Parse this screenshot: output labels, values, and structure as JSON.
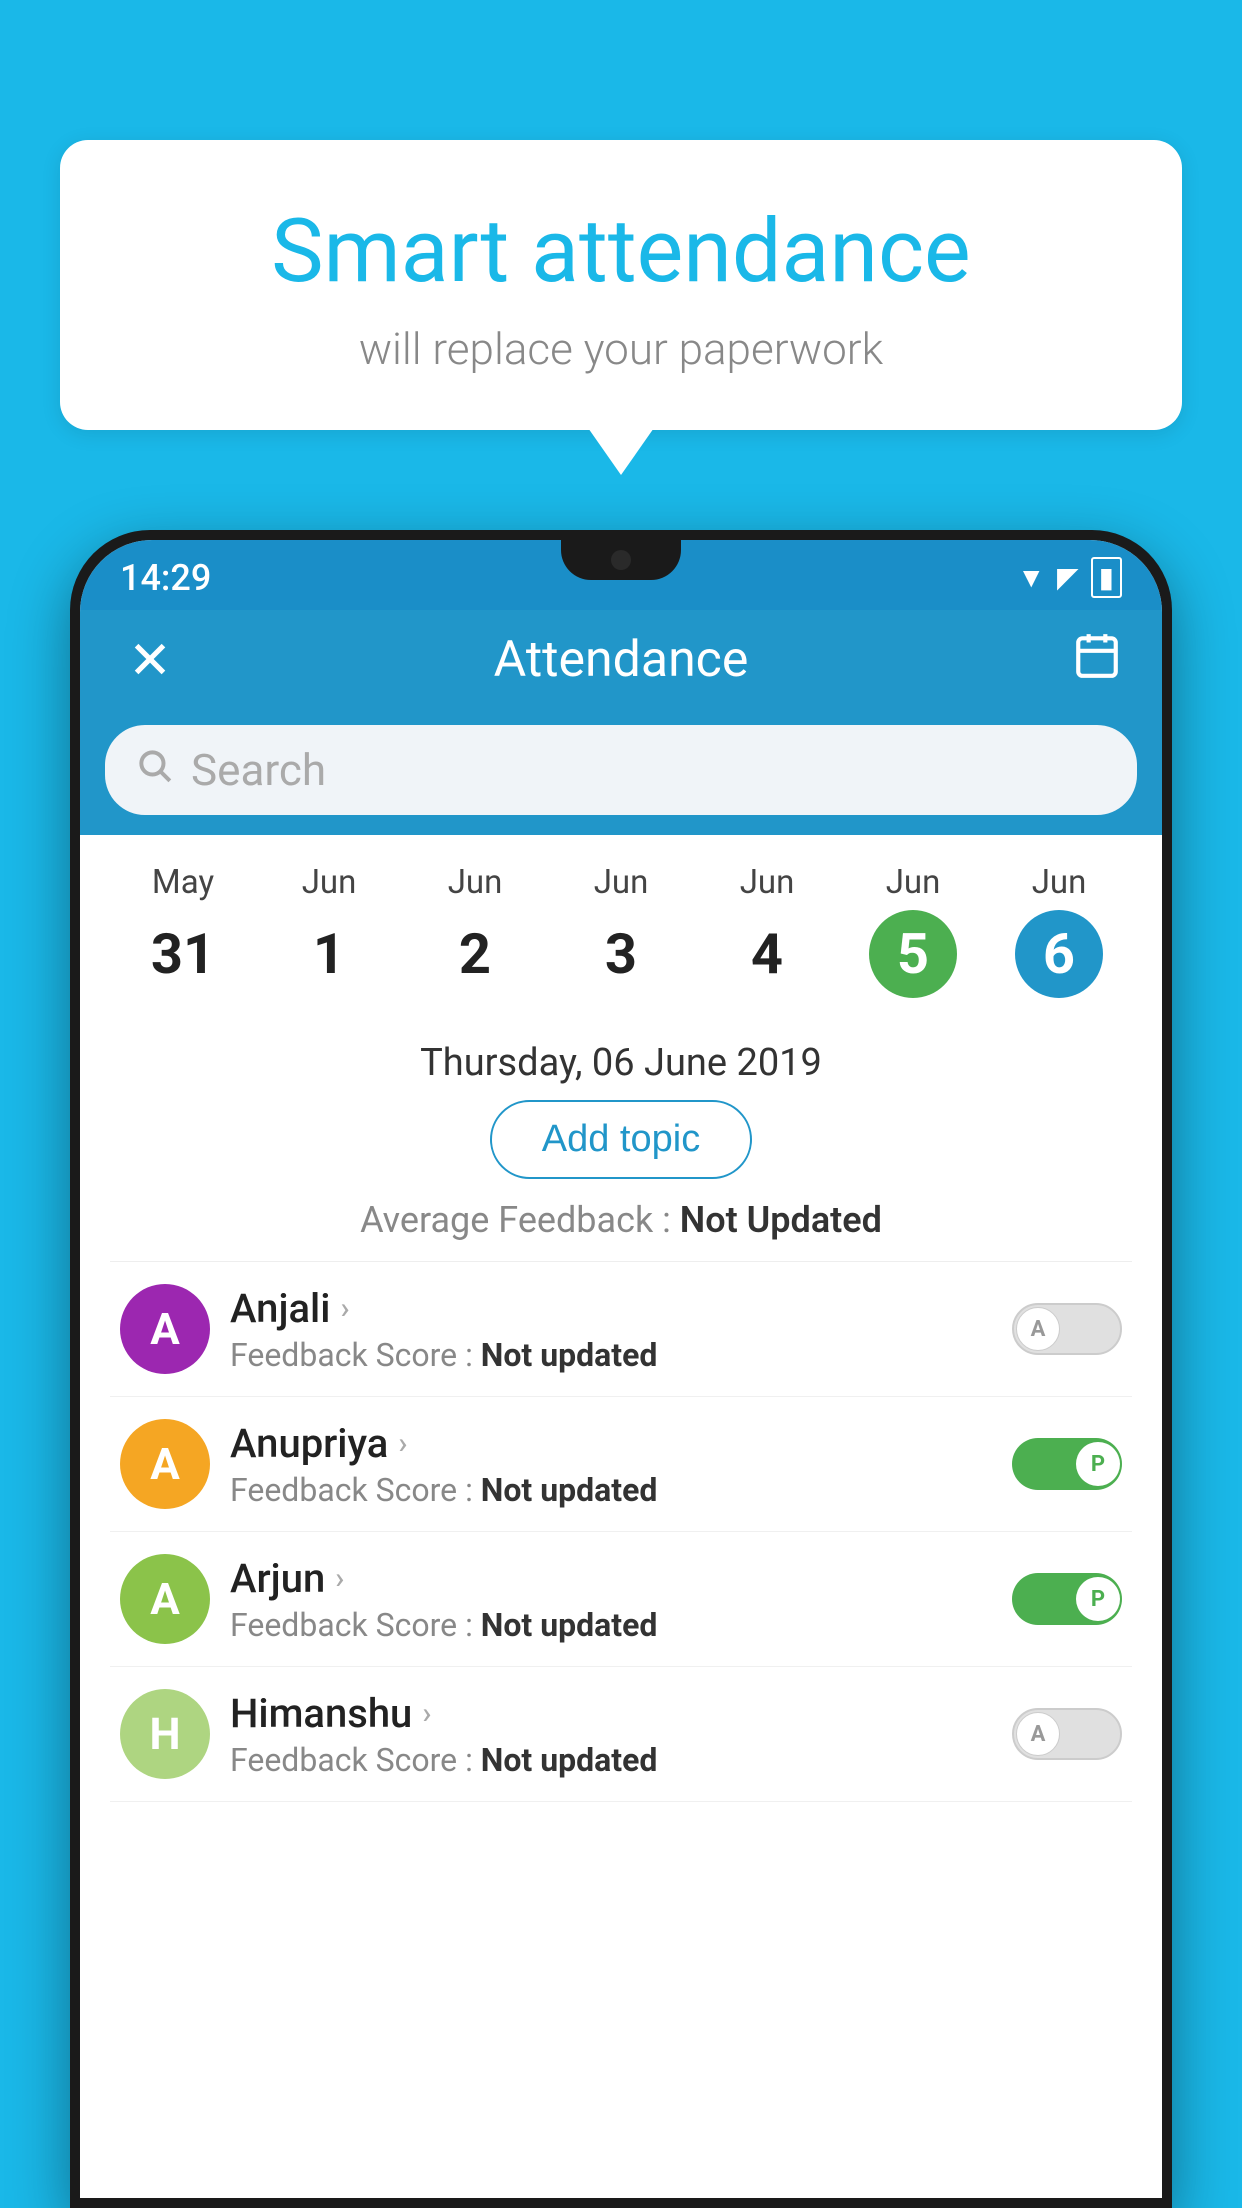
{
  "background_color": "#1ab8e8",
  "bubble": {
    "title": "Smart attendance",
    "subtitle": "will replace your paperwork"
  },
  "status_bar": {
    "time": "14:29",
    "wifi": "▼",
    "signal": "▲",
    "battery": "▮"
  },
  "header": {
    "close_label": "✕",
    "title": "Attendance",
    "calendar_icon": "📅"
  },
  "search": {
    "placeholder": "Search"
  },
  "calendar": {
    "months": [
      "May",
      "Jun",
      "Jun",
      "Jun",
      "Jun",
      "Jun",
      "Jun"
    ],
    "dates": [
      "31",
      "1",
      "2",
      "3",
      "4",
      "5",
      "6"
    ],
    "today_index": 5,
    "selected_index": 6
  },
  "date_display": "Thursday, 06 June 2019",
  "add_topic_label": "Add topic",
  "avg_feedback_label": "Average Feedback :",
  "avg_feedback_value": "Not Updated",
  "students": [
    {
      "name": "Anjali",
      "initial": "A",
      "avatar_color": "#9c27b0",
      "feedback_label": "Feedback Score :",
      "feedback_value": "Not updated",
      "status": "absent"
    },
    {
      "name": "Anupriya",
      "initial": "A",
      "avatar_color": "#f5a623",
      "feedback_label": "Feedback Score :",
      "feedback_value": "Not updated",
      "status": "present"
    },
    {
      "name": "Arjun",
      "initial": "A",
      "avatar_color": "#8bc34a",
      "feedback_label": "Feedback Score :",
      "feedback_value": "Not updated",
      "status": "present"
    },
    {
      "name": "Himanshu",
      "initial": "H",
      "avatar_color": "#aed581",
      "feedback_label": "Feedback Score :",
      "feedback_value": "Not updated",
      "status": "absent"
    }
  ]
}
